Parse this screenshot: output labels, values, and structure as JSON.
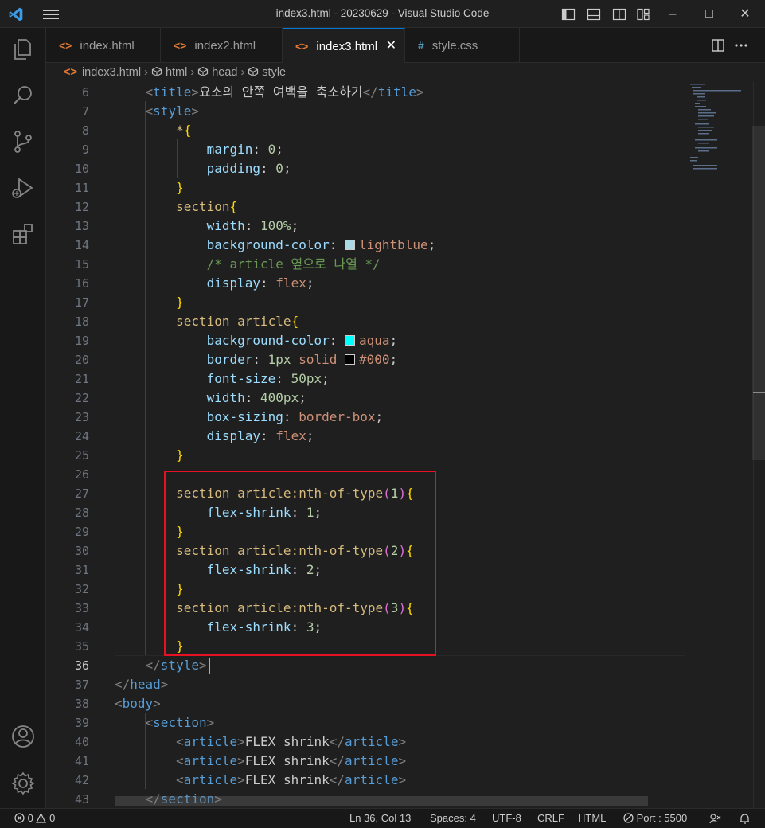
{
  "window": {
    "title": "index3.html - 20230629 - Visual Studio Code"
  },
  "tabs": [
    {
      "label": "index.html",
      "icon": "html-file-icon",
      "active": false
    },
    {
      "label": "index2.html",
      "icon": "html-file-icon",
      "active": false
    },
    {
      "label": "index3.html",
      "icon": "html-file-icon",
      "active": true
    },
    {
      "label": "style.css",
      "icon": "css-file-icon",
      "active": false
    }
  ],
  "breadcrumb": {
    "file": "index3.html",
    "item1": "html",
    "item2": "head",
    "item3": "style"
  },
  "colors": {
    "accent": "#0078d4",
    "highlight_box": "#e81123",
    "swatch_lightblue": "#add8e6",
    "swatch_aqua": "#00ffff",
    "swatch_black": "#000000"
  },
  "editor": {
    "line_numbers": [
      "6",
      "7",
      "8",
      "9",
      "10",
      "11",
      "12",
      "13",
      "14",
      "15",
      "16",
      "17",
      "18",
      "19",
      "20",
      "21",
      "22",
      "23",
      "24",
      "25",
      "26",
      "27",
      "28",
      "29",
      "30",
      "31",
      "32",
      "33",
      "34",
      "35",
      "36",
      "37",
      "38",
      "39",
      "40",
      "41",
      "42",
      "43"
    ],
    "active_line": "36",
    "code": {
      "l6_open": "<",
      "l6_tag": "title",
      "l6_text": "요소의 안쪽 여백을 축소하기",
      "l6_close_tag": "title",
      "l7_tag": "style",
      "l8_sel": "*",
      "l9_prop": "margin",
      "l9_val": "0",
      "l10_prop": "padding",
      "l10_val": "0",
      "l12_sel": "section",
      "l13_prop": "width",
      "l13_val": "100%",
      "l14_prop": "background-color",
      "l14_val": "lightblue",
      "l15_cmt": "/* article 옆으로 나열 */",
      "l16_prop": "display",
      "l16_val": "flex",
      "l18_sel": "section article",
      "l19_prop": "background-color",
      "l19_val": "aqua",
      "l20_prop": "border",
      "l20_num": "1px",
      "l20_val": "solid",
      "l20_color": "#000",
      "l21_prop": "font-size",
      "l21_val": "50px",
      "l22_prop": "width",
      "l22_val": "400px",
      "l23_prop": "box-sizing",
      "l23_val": "border-box",
      "l24_prop": "display",
      "l24_val": "flex",
      "l27_sel": "section article:nth-of-type",
      "l27_arg": "1",
      "l28_prop": "flex-shrink",
      "l28_val": "1",
      "l30_sel": "section article:nth-of-type",
      "l30_arg": "2",
      "l31_prop": "flex-shrink",
      "l31_val": "2",
      "l33_sel": "section article:nth-of-type",
      "l33_arg": "3",
      "l34_prop": "flex-shrink",
      "l34_val": "3",
      "l36_tag": "style",
      "l37_tag": "head",
      "l38_tag": "body",
      "l39_tag": "section",
      "article_tag": "article",
      "article_text": "FLEX shrink",
      "l43_tag": "section"
    }
  },
  "statusbar": {
    "errors": "0",
    "warnings": "0",
    "position": "Ln 36, Col 13",
    "spaces": "Spaces: 4",
    "encoding": "UTF-8",
    "eol": "CRLF",
    "language": "HTML",
    "port": "Port : 5500"
  }
}
